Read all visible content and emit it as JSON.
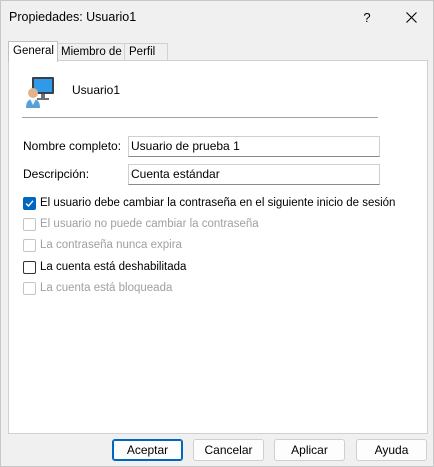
{
  "window": {
    "title": "Propiedades: Usuario1",
    "help_label": "?"
  },
  "tabs": [
    {
      "label": "General"
    },
    {
      "label": "Miembro de"
    },
    {
      "label": "Perfil"
    }
  ],
  "user": {
    "name": "Usuario1",
    "icon": "user-monitor-icon"
  },
  "form": {
    "full_name_label": "Nombre completo:",
    "full_name_value": "Usuario de prueba 1",
    "description_label": "Descripción:",
    "description_value": "Cuenta estándar"
  },
  "options": [
    {
      "label": "El usuario debe cambiar la contraseña en el siguiente inicio de sesión",
      "checked": true,
      "enabled": true
    },
    {
      "label": "El usuario no puede cambiar la contraseña",
      "checked": false,
      "enabled": false
    },
    {
      "label": "La contraseña nunca expira",
      "checked": false,
      "enabled": false
    },
    {
      "label": "La cuenta está deshabilitada",
      "checked": false,
      "enabled": true
    },
    {
      "label": "La cuenta está bloqueada",
      "checked": false,
      "enabled": false
    }
  ],
  "buttons": {
    "ok": "Aceptar",
    "cancel": "Cancelar",
    "apply": "Aplicar",
    "help": "Ayuda"
  },
  "colors": {
    "accent": "#0067c0",
    "window_bg": "#f0f0f0",
    "panel_bg": "#ffffff",
    "disabled_text": "#a0a0a0"
  }
}
